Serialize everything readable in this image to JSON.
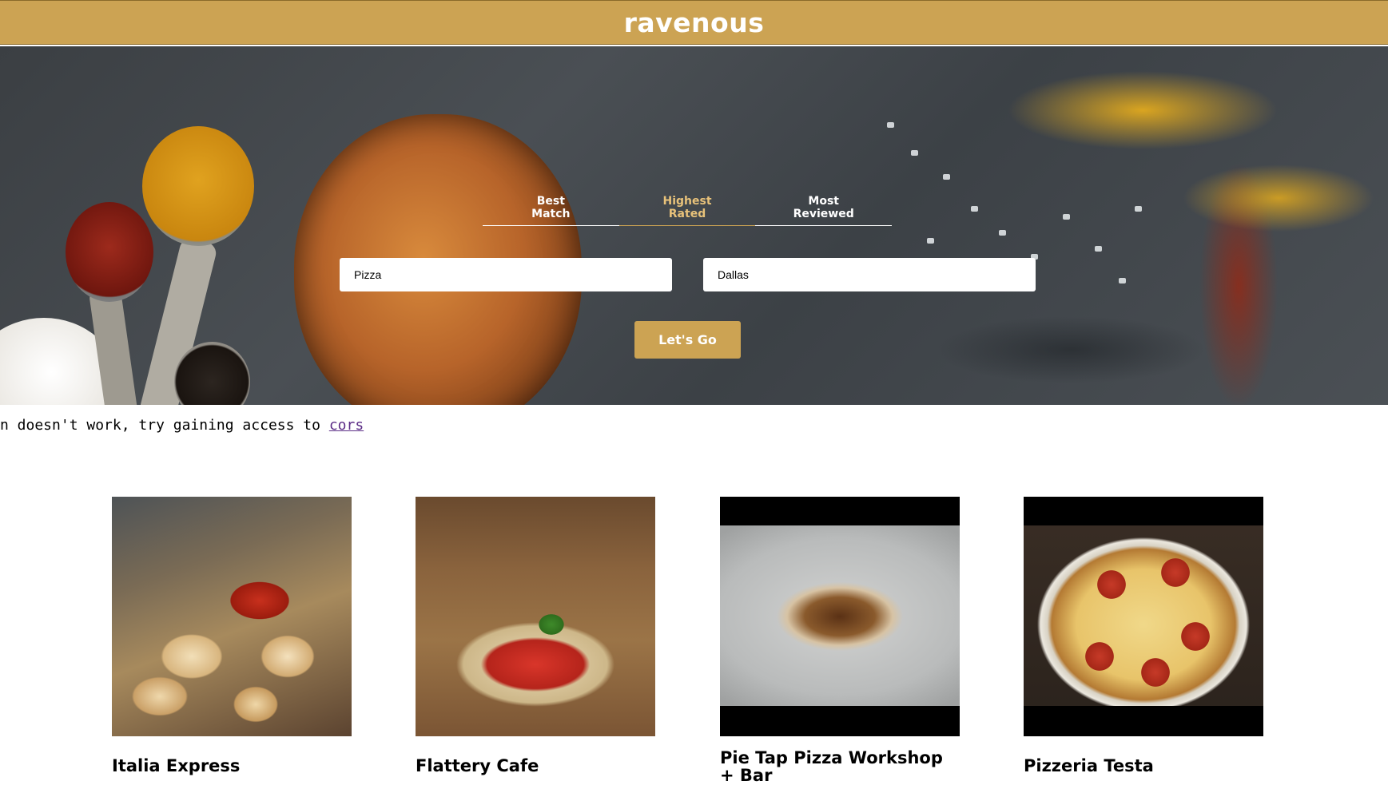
{
  "header": {
    "logo": "ravenous"
  },
  "sort": {
    "options": [
      {
        "label": "Best\nMatch",
        "active": false
      },
      {
        "label": "Highest\nRated",
        "active": true
      },
      {
        "label": "Most\nReviewed",
        "active": false
      }
    ]
  },
  "search": {
    "term_value": "Pizza",
    "location_value": "Dallas",
    "submit_label": "Let's Go"
  },
  "notice": {
    "text": "n doesn't work, try gaining access to ",
    "link_label": "cors"
  },
  "businesses": [
    {
      "name": "Italia Express"
    },
    {
      "name": "Flattery Cafe"
    },
    {
      "name": "Pie Tap Pizza Workshop + Bar"
    },
    {
      "name": "Pizzeria Testa"
    }
  ],
  "colors": {
    "accent": "#cca353",
    "active_tab": "#e8c27a",
    "link": "#5b2c86"
  }
}
